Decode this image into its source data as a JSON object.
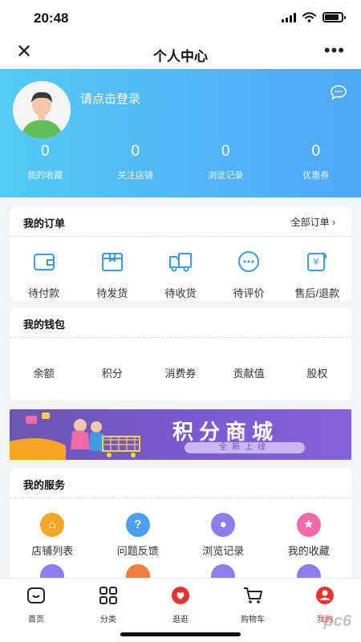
{
  "status_bar": {
    "time": "20:48"
  },
  "nav": {
    "title": "个人中心",
    "close_icon": "close-icon",
    "more_icon": "more-dots-icon"
  },
  "profile": {
    "login_text": "请点击登录",
    "stats": [
      {
        "value": "0",
        "label": "我的收藏"
      },
      {
        "value": "0",
        "label": "关注店铺"
      },
      {
        "value": "0",
        "label": "浏览记录"
      },
      {
        "value": "0",
        "label": "优惠券"
      }
    ],
    "header_colors": [
      "#55c9f5",
      "#4fa7f6"
    ]
  },
  "orders": {
    "title": "我的订单",
    "all_link": "全部订单",
    "items": [
      {
        "label": "待付款",
        "icon": "wallet-icon"
      },
      {
        "label": "待发货",
        "icon": "box-icon"
      },
      {
        "label": "待收货",
        "icon": "truck-icon"
      },
      {
        "label": "待评价",
        "icon": "comment-icon"
      },
      {
        "label": "售后/退款",
        "icon": "refund-icon"
      }
    ]
  },
  "wallet": {
    "title": "我的钱包",
    "items": [
      "余额",
      "积分",
      "消费券",
      "贡献值",
      "股权"
    ]
  },
  "banner": {
    "title": "积分商城",
    "subtitle": "全新上线"
  },
  "services": {
    "title": "我的服务",
    "items": [
      {
        "label": "店铺列表",
        "icon": "store-icon",
        "color": "#f5a623"
      },
      {
        "label": "问题反馈",
        "icon": "question-icon",
        "color": "#4a9ff5"
      },
      {
        "label": "浏览记录",
        "icon": "footprint-icon",
        "color": "#8e7cf0"
      },
      {
        "label": "我的收藏",
        "icon": "star-icon",
        "color": "#f06aa8"
      }
    ],
    "partial_icons": [
      {
        "icon": "footprint-icon",
        "color": "#8e7cf0"
      },
      {
        "icon": "location-icon",
        "color": "#f57c3a"
      },
      {
        "icon": "heart-icon",
        "color": "#8e7cf0"
      },
      {
        "icon": "footprint-icon",
        "color": "#8e7cf0"
      }
    ]
  },
  "tabbar": {
    "items": [
      {
        "label": "首页",
        "icon": "home-icon"
      },
      {
        "label": "分类",
        "icon": "category-icon"
      },
      {
        "label": "逛逛",
        "icon": "explore-icon"
      },
      {
        "label": "购物车",
        "icon": "cart-icon"
      },
      {
        "label": "我的",
        "icon": "profile-icon",
        "active": true
      }
    ],
    "active_color": "#e8322d"
  },
  "watermark": "pc6"
}
